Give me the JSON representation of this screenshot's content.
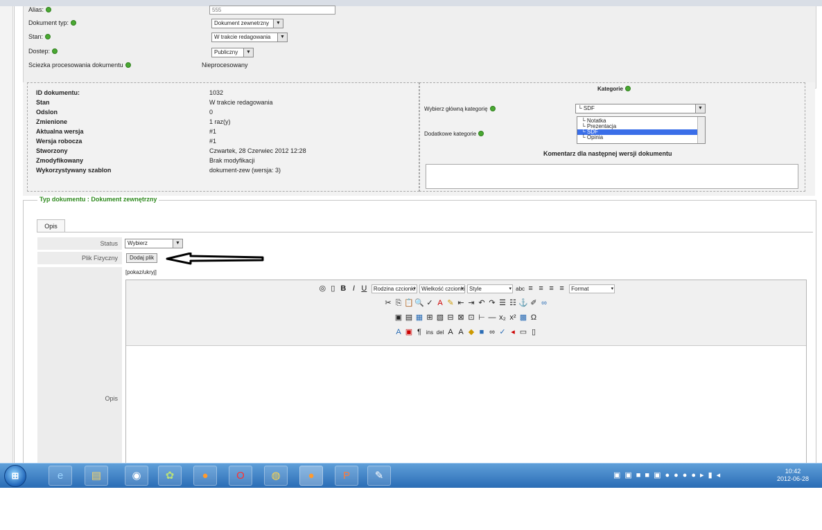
{
  "top_form": {
    "alias_label": "Alias:",
    "alias_value": "555",
    "doc_type_label": "Dokument typ:",
    "doc_type_value": "Dokument zewnetrzny",
    "state_label": "Stan:",
    "state_value": "W trakcie redagowania",
    "access_label": "Dostep:",
    "access_value": "Publiczny",
    "path_label": "Sciezka procesowania dokumentu",
    "path_value": "Nieprocesowany"
  },
  "info": {
    "rows": [
      {
        "label": "ID dokumentu:",
        "value": "1032"
      },
      {
        "label": "Stan",
        "value": "W trakcie redagowania"
      },
      {
        "label": "Odslon",
        "value": "0"
      },
      {
        "label": "Zmienione",
        "value": "1 raz(y)"
      },
      {
        "label": "Aktualna wersja",
        "value": "#1"
      },
      {
        "label": "Wersja robocza",
        "value": "#1"
      },
      {
        "label": "Stworzony",
        "value": "Czwartek, 28 Czerwiec 2012 12:28"
      },
      {
        "label": "Zmodyfikowany",
        "value": "Brak modyfikacji"
      },
      {
        "label": "Wykorzystywany szablon",
        "value": "dokument-zew (wersja: 3)"
      }
    ]
  },
  "categories": {
    "title": "Kategorie",
    "main_label": "Wybierz główną kategorię",
    "main_value": "└ SDF",
    "extra_label": "Dodatkowe kategorie",
    "extra_items": [
      "└ Notatka",
      "└ Prezentacja",
      "└ SDF",
      "└ Opinia"
    ],
    "comment_label": "Komentarz dla następnej wersji dokumentu"
  },
  "doc_section": {
    "legend": "Typ dokumentu : Dokument zewnętrzny",
    "tab_label": "Opis",
    "status_label": "Status",
    "status_value": "Wybierz",
    "file_label": "Plik Fizyczny",
    "add_file_button": "Dodaj plik",
    "toggle_link": "[pokaz/ukryj]",
    "description_label": "Opis"
  },
  "editor": {
    "font_family": "Rodzina czcionki",
    "font_size": "Wielkość czcionki",
    "style": "Style",
    "format": "Format"
  },
  "taskbar": {
    "time": "10:42",
    "date": "2012-06-28"
  },
  "colors": {
    "legend_green": "#2f8a1f",
    "taskbar": "#2a6cb5",
    "selected_item": "#3a6ee8"
  }
}
